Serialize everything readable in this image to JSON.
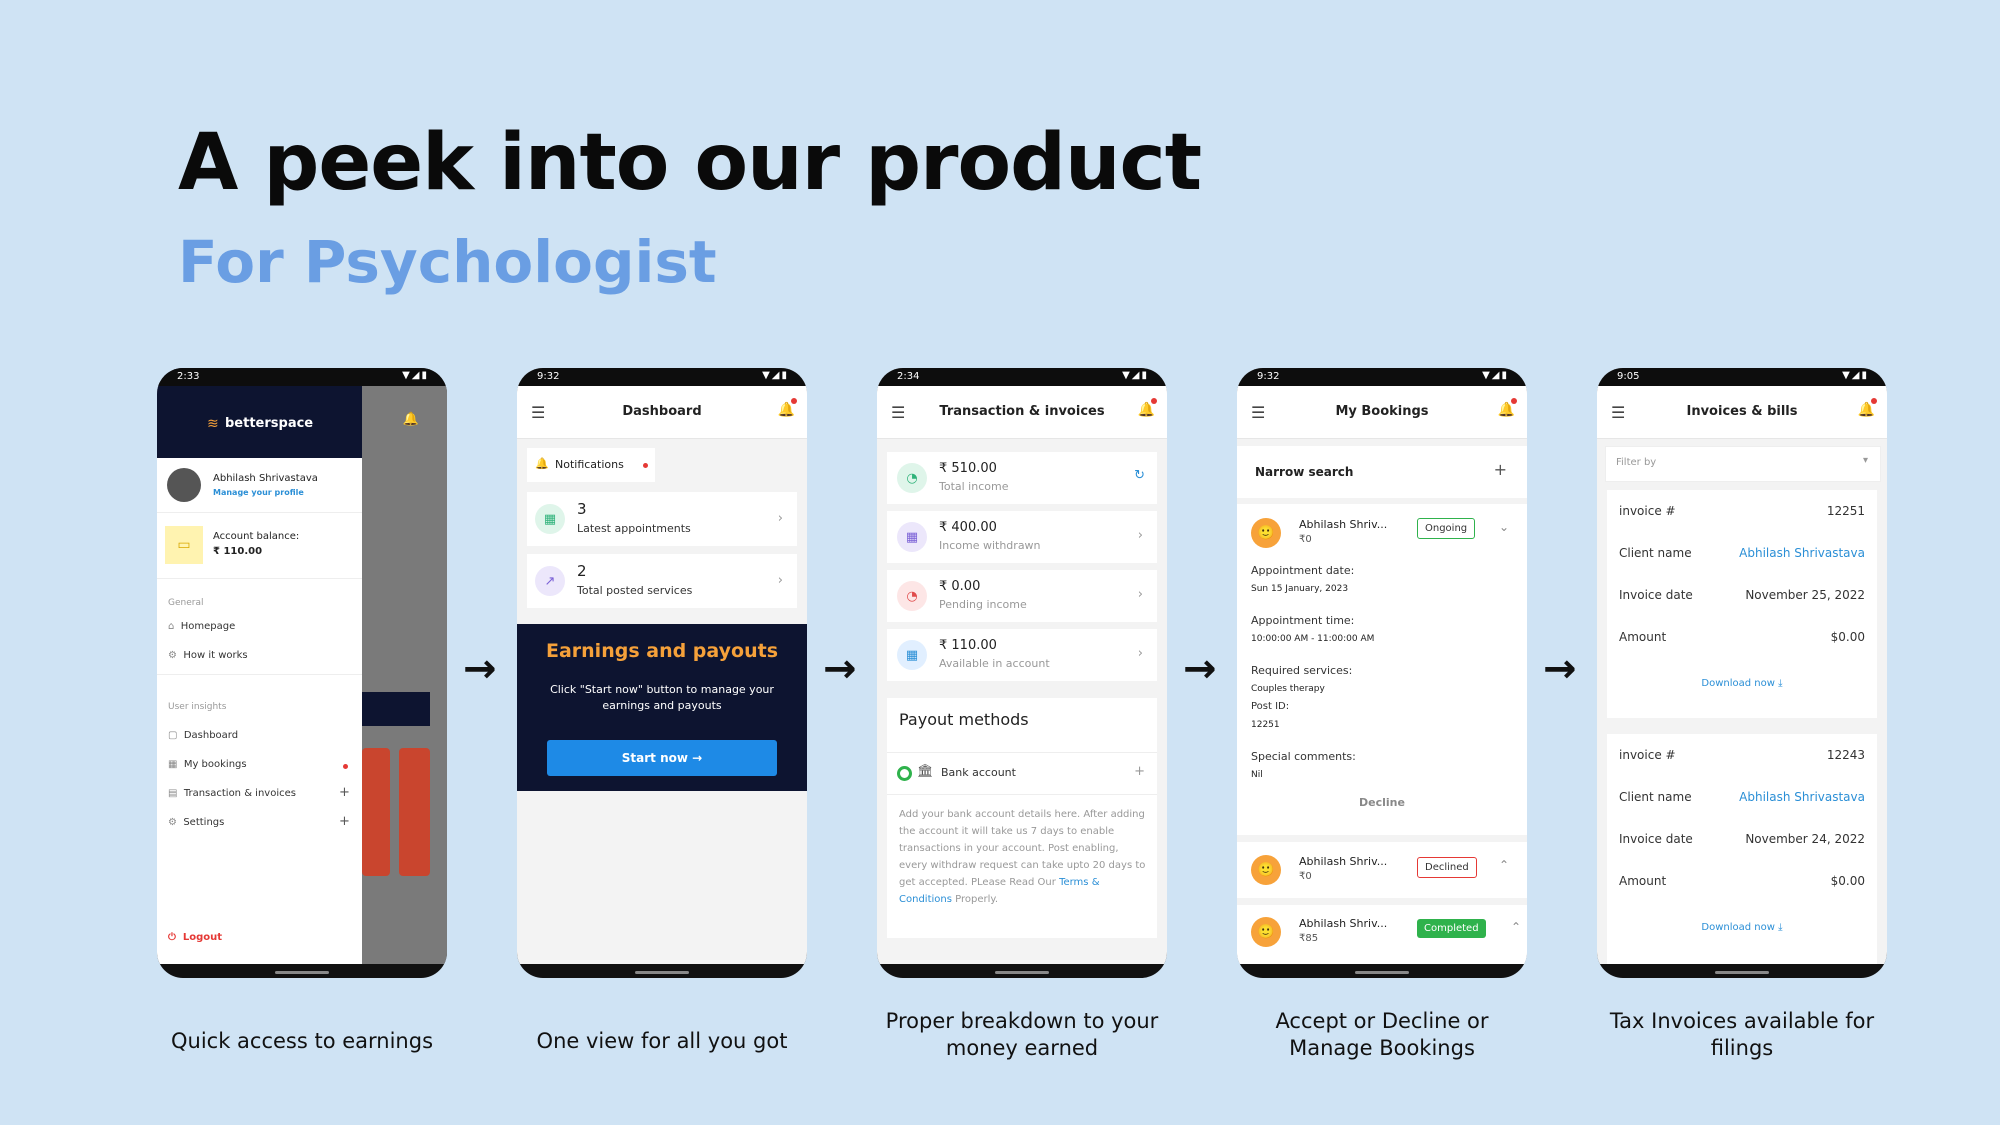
{
  "header": {
    "title": "A peek into our product",
    "subtitle": "For Psychologist"
  },
  "arrows": [
    "→",
    "→",
    "→",
    "→"
  ],
  "captions": {
    "c1": "Quick access to earnings",
    "c2": "One view for all you got",
    "c3": "Proper breakdown to your money earned",
    "c4": "Accept or Decline or Manage Bookings",
    "c5": "Tax Invoices available for filings"
  },
  "icons": {
    "menu": "menu-icon",
    "bell": "bell-icon",
    "chevron": "chevron-right-icon",
    "plus": "plus-icon",
    "download": "download-icon"
  },
  "colors": {
    "accent_blue": "#2b8fd6",
    "navy": "#0d1430",
    "orange": "#f5a13a",
    "green": "#2fb24c",
    "red": "#e53935"
  },
  "phone1": {
    "time": "2:33",
    "brand": "betterspace",
    "user_name": "Abhilash Shrivastava",
    "manage_profile": "Manage your profile",
    "balance_label": "Account balance:",
    "balance_value": "₹ 110.00",
    "section_general": "General",
    "nav_general": [
      "Homepage",
      "How it works"
    ],
    "section_insights": "User insights",
    "nav_insights": [
      "Dashboard",
      "My bookings",
      "Transaction & invoices",
      "Settings"
    ],
    "logout": "Logout",
    "plus": "+"
  },
  "phone2": {
    "time": "9:32",
    "title": "Dashboard",
    "notifications": "Notifications",
    "stat1_value": "3",
    "stat1_label": "Latest appointments",
    "stat2_value": "2",
    "stat2_label": "Total posted services",
    "promo_title": "Earnings and payouts",
    "promo_text": "Click \"Start now\" button to manage your earnings and payouts",
    "promo_button": "Start now"
  },
  "phone3": {
    "time": "2:34",
    "title": "Transaction & invoices",
    "rows": [
      {
        "amount": "₹ 510.00",
        "label": "Total income"
      },
      {
        "amount": "₹ 400.00",
        "label": "Income withdrawn"
      },
      {
        "amount": "₹ 0.00",
        "label": "Pending income"
      },
      {
        "amount": "₹ 110.00",
        "label": "Available in account"
      }
    ],
    "payout_title": "Payout methods",
    "bank_label": "Bank account",
    "bank_text": "Add your bank account details here. After adding the account it will take us 7 days to enable transactions in your account. Post enabling, every withdraw request can take upto 20 days to get accepted. PLease Read Our",
    "terms_link": "Terms & Conditions",
    "terms_tail": "Properly."
  },
  "phone4": {
    "time": "9:32",
    "title": "My Bookings",
    "narrow": "Narrow search",
    "b1_name": "Abhilash Shriv...",
    "b1_price": "₹0",
    "b1_status": "Ongoing",
    "date_label": "Appointment date:",
    "date_value": "Sun 15 January, 2023",
    "time_label": "Appointment time:",
    "time_value": "10:00:00 AM - 11:00:00 AM",
    "services_label": "Required services:",
    "services_value": "Couples therapy",
    "post_label": "Post ID:",
    "post_value": "12251",
    "comments_label": "Special comments:",
    "comments_value": "Nil",
    "decline": "Decline",
    "b2_name": "Abhilash Shriv...",
    "b2_price": "₹0",
    "b2_status": "Declined",
    "b3_name": "Abhilash Shriv...",
    "b3_price": "₹85",
    "b3_status": "Completed"
  },
  "phone5": {
    "time": "9:05",
    "title": "Invoices & bills",
    "filter": "Filter by",
    "labels": {
      "invoice": "invoice #",
      "client": "Client name",
      "date": "Invoice date",
      "amount": "Amount"
    },
    "inv1": {
      "number": "12251",
      "client": "Abhilash Shrivastava",
      "date": "November 25, 2022",
      "amount": "$0.00"
    },
    "inv2": {
      "number": "12243",
      "client": "Abhilash Shrivastava",
      "date": "November 24, 2022",
      "amount": "$0.00"
    },
    "download": "Download now"
  }
}
